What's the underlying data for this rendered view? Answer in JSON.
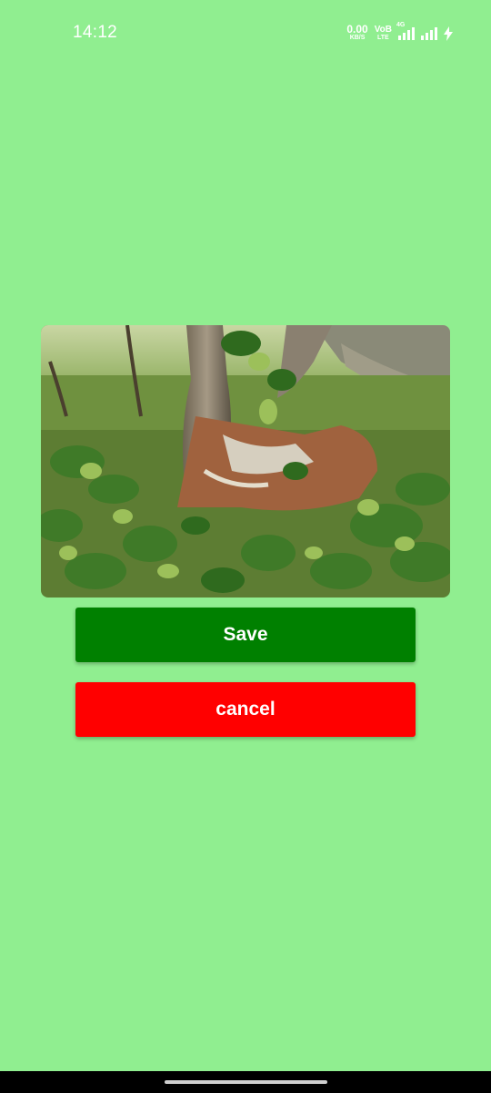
{
  "status_bar": {
    "time": "14:12",
    "net_speed_value": "0.00",
    "net_speed_unit": "KB/S",
    "volte_top": "VoB",
    "volte_bottom": "LTE",
    "network_type": "4G",
    "icons": [
      "signal-icon-sim1",
      "signal-icon-sim2",
      "charging-bolt-icon"
    ]
  },
  "preview": {
    "image_description": "photo-preview",
    "colors": {
      "background": "#90EE90"
    }
  },
  "actions": {
    "save_label": "Save",
    "cancel_label": "cancel",
    "save_color": "#008000",
    "cancel_color": "#FF0000"
  },
  "nav_bar": {
    "icon": "home-gesture-pill"
  }
}
